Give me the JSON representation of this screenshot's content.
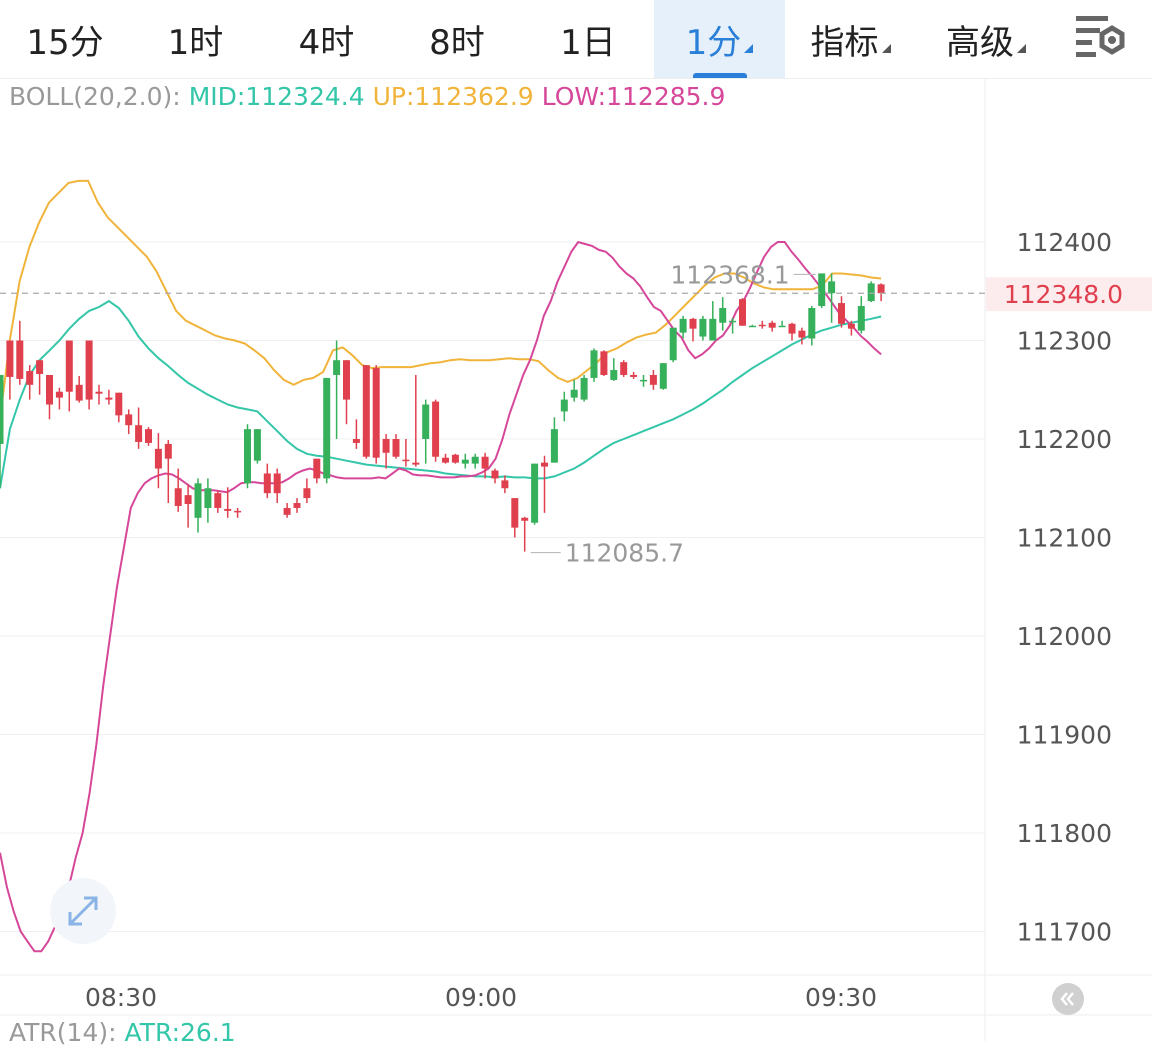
{
  "tabs": [
    {
      "label": "15分",
      "active": false,
      "dropdown": false
    },
    {
      "label": "1时",
      "active": false,
      "dropdown": false
    },
    {
      "label": "4时",
      "active": false,
      "dropdown": false
    },
    {
      "label": "8时",
      "active": false,
      "dropdown": false
    },
    {
      "label": "1日",
      "active": false,
      "dropdown": false
    },
    {
      "label": "1分",
      "active": true,
      "dropdown": true
    },
    {
      "label": "指标",
      "active": false,
      "dropdown": true
    },
    {
      "label": "高级",
      "active": false,
      "dropdown": true
    }
  ],
  "settings_icon": "chart-settings-icon",
  "legend": {
    "name": "BOLL(20,2.0):",
    "mid": "MID:112324.4",
    "up": "UP:112362.9",
    "low": "LOW:112285.9"
  },
  "atr": {
    "name": "ATR(14):",
    "value": "ATR:26.1"
  },
  "colors": {
    "up": "#36b05a",
    "down": "#e0404e",
    "mid": "#33c6a8",
    "upper": "#f0b43a",
    "lower": "#d6479a",
    "label": "#999999",
    "accent": "#2a7fd8"
  },
  "chart_data": {
    "type": "candlestick",
    "ylim": [
      111680,
      112480
    ],
    "y_ticks": [
      "112400",
      "112300",
      "112200",
      "112100",
      "112000",
      "111900",
      "111800",
      "111700"
    ],
    "x_ticks": [
      "08:30",
      "09:00",
      "09:30"
    ],
    "current_price": "112348.0",
    "high_label": "112368.1",
    "low_label": "112085.7",
    "candles": [
      [
        112195,
        112265,
        112150,
        112265
      ],
      [
        112300,
        112263,
        112240,
        112300
      ],
      [
        112300,
        112261,
        112255,
        112320
      ],
      [
        112269,
        112255,
        112240,
        112275
      ],
      [
        112280,
        112266,
        112245,
        112280
      ],
      [
        112265,
        112235,
        112220,
        112265
      ],
      [
        112248,
        112242,
        112230,
        112252
      ],
      [
        112300,
        112248,
        112228,
        112300
      ],
      [
        112255,
        112239,
        112237,
        112264
      ],
      [
        112300,
        112240,
        112230,
        112300
      ],
      [
        112248,
        112246,
        112235,
        112255
      ],
      [
        112242,
        112240,
        112235,
        112250
      ],
      [
        112247,
        112224,
        112217,
        112247
      ],
      [
        112225,
        112214,
        112205,
        112230
      ],
      [
        112214,
        112197,
        112190,
        112232
      ],
      [
        112210,
        112196,
        112193,
        112212
      ],
      [
        112190,
        112170,
        112150,
        112206
      ],
      [
        112195,
        112180,
        112135,
        112199
      ],
      [
        112150,
        112132,
        112126,
        112170
      ],
      [
        112143,
        112134,
        112110,
        112154
      ],
      [
        112120,
        112155,
        112105,
        112160
      ],
      [
        112130,
        112150,
        112115,
        112160
      ],
      [
        112145,
        112130,
        112125,
        112147
      ],
      [
        112129,
        112127,
        112120,
        112151
      ],
      [
        112127,
        112126,
        112120,
        112130
      ],
      [
        112155,
        112210,
        112150,
        112215
      ],
      [
        112178,
        112210,
        112175,
        112210
      ],
      [
        112165,
        112145,
        112140,
        112175
      ],
      [
        112165,
        112145,
        112135,
        112170
      ],
      [
        112130,
        112123,
        112120,
        112135
      ],
      [
        112135,
        112130,
        112125,
        112140
      ],
      [
        112150,
        112140,
        112135,
        112160
      ],
      [
        112180,
        112160,
        112155,
        112180
      ],
      [
        112160,
        112262,
        112155,
        112262
      ],
      [
        112265,
        112280,
        112200,
        112300
      ],
      [
        112280,
        112240,
        112215,
        112280
      ],
      [
        112200,
        112196,
        112190,
        112220
      ],
      [
        112275,
        112182,
        112180,
        112275
      ],
      [
        112272,
        112181,
        112175,
        112275
      ],
      [
        112200,
        112186,
        112170,
        112205
      ],
      [
        112200,
        112182,
        112180,
        112205
      ],
      [
        112179,
        112178,
        112172,
        112200
      ],
      [
        112176,
        112174,
        112172,
        112265
      ],
      [
        112200,
        112235,
        112175,
        112240
      ],
      [
        112238,
        112182,
        112177,
        112240
      ],
      [
        112181,
        112176,
        112175,
        112185
      ],
      [
        112184,
        112176,
        112175,
        112185
      ],
      [
        112175,
        112179,
        112170,
        112185
      ],
      [
        112175,
        112182,
        112170,
        112185
      ],
      [
        112182,
        112170,
        112160,
        112186
      ],
      [
        112168,
        112160,
        112155,
        112170
      ],
      [
        112158,
        112150,
        112145,
        112163
      ],
      [
        112140,
        112110,
        112100,
        112140
      ],
      [
        112120,
        112117,
        112085.7,
        112121
      ],
      [
        112115,
        112175,
        112113,
        112175
      ],
      [
        112176,
        112172,
        112125,
        112183
      ],
      [
        112176,
        112210,
        112176,
        112222
      ],
      [
        112228,
        112240,
        112218,
        112248
      ],
      [
        112242,
        112250,
        112238,
        112260
      ],
      [
        112240,
        112262,
        112238,
        112265
      ],
      [
        112262,
        112290,
        112258,
        112292
      ],
      [
        112289,
        112265,
        112264,
        112290
      ],
      [
        112260,
        112270,
        112259,
        112282
      ],
      [
        112278,
        112265,
        112263,
        112280
      ],
      [
        112265,
        112263,
        112261,
        112268
      ],
      [
        112260,
        112260,
        112253,
        112265
      ],
      [
        112265,
        112255,
        112250,
        112270
      ],
      [
        112251,
        112277,
        112250,
        112277
      ],
      [
        112280,
        112313,
        112278,
        112313
      ],
      [
        112308,
        112322,
        112302,
        112325
      ],
      [
        112322,
        112312,
        112299,
        112323
      ],
      [
        112304,
        112322,
        112300,
        112325
      ],
      [
        112300,
        112322,
        112300,
        112340
      ],
      [
        112318,
        112333,
        112310,
        112344
      ],
      [
        112320,
        112320,
        112307,
        112323
      ],
      [
        112342,
        112315,
        112315,
        112343
      ],
      [
        112315,
        112315,
        112315,
        112316
      ],
      [
        112316,
        112315,
        112312,
        112320
      ],
      [
        112318,
        112313,
        112309,
        112320
      ],
      [
        112315,
        112315,
        112315,
        112320
      ],
      [
        112317,
        112307,
        112300,
        112318
      ],
      [
        112310,
        112303,
        112296,
        112313
      ],
      [
        112302,
        112333,
        112295,
        112335
      ],
      [
        112335,
        112368.1,
        112333,
        112368.1
      ],
      [
        112348,
        112360,
        112318,
        112368
      ],
      [
        112338,
        112317,
        112313,
        112345
      ],
      [
        112317,
        112312,
        112305,
        112320
      ],
      [
        112310,
        112335,
        112307,
        112345
      ],
      [
        112340,
        112358,
        112339,
        112360
      ],
      [
        112357,
        112348,
        112340,
        112358
      ]
    ],
    "mid_series": [
      112150,
      112210,
      112240,
      112265,
      112280,
      112290,
      112300,
      112312,
      112322,
      112330,
      112334,
      112340,
      112333,
      112320,
      112304,
      112292,
      112282,
      112274,
      112265,
      112257,
      112251,
      112245,
      112240,
      112235,
      112232,
      112230,
      112228,
      112218,
      112208,
      112198,
      112190,
      112185,
      112183,
      112182,
      112180,
      112178,
      112176,
      112174,
      112173,
      112172,
      112171,
      112170,
      112169,
      112168,
      112167,
      112165,
      112164,
      112163,
      112162,
      112162,
      112161,
      112162,
      112161,
      112161,
      112160,
      112160,
      112162,
      112166,
      112170,
      112176,
      112183,
      112190,
      112196,
      112200,
      112204,
      112208,
      112212,
      112216,
      112220,
      112225,
      112230,
      112236,
      112243,
      112250,
      112258,
      112265,
      112272,
      112278,
      112284,
      112290,
      112296,
      112301,
      112306,
      112310,
      112313,
      112316,
      112318,
      112320,
      112322,
      112324.4
    ],
    "upper_series": [
      112220,
      112300,
      112360,
      112395,
      112420,
      112440,
      112450,
      112460,
      112462,
      112462,
      112440,
      112425,
      112415,
      112405,
      112395,
      112385,
      112370,
      112350,
      112330,
      112320,
      112315,
      112310,
      112305,
      112302,
      112300,
      112297,
      112290,
      112282,
      112270,
      112260,
      112255,
      112260,
      112262,
      112268,
      112290,
      112293,
      112285,
      112275,
      112272,
      112273,
      112273,
      112273,
      112273,
      112275,
      112277,
      112278,
      112280,
      112281,
      112280,
      112280,
      112280,
      112281,
      112282,
      112281,
      112281,
      112279,
      112270,
      112262,
      112258,
      112262,
      112270,
      112278,
      112288,
      112292,
      112298,
      112303,
      112306,
      112308,
      112316,
      112326,
      112336,
      112346,
      112356,
      112364,
      112368,
      112368,
      112364,
      112358,
      112354,
      112352,
      112352,
      112352,
      112352,
      112352,
      112356,
      112368,
      112368,
      112367,
      112366,
      112364,
      112362.9
    ],
    "lower_series": [
      111780,
      111745,
      111720,
      111700,
      111690,
      111680,
      111680,
      111690,
      111705,
      111720,
      111745,
      111775,
      111800,
      111840,
      111890,
      111950,
      112000,
      112050,
      112090,
      112130,
      112145,
      112155,
      112160,
      112163,
      112165,
      112164,
      112160,
      112155,
      112150,
      112148,
      112148,
      112148,
      112147,
      112146,
      112150,
      112155,
      112156,
      112156,
      112155,
      112155,
      112155,
      112156,
      112160,
      112165,
      112168,
      112170,
      112168,
      112165,
      112163,
      112161,
      112160,
      112160,
      112160,
      112160,
      112160,
      112161,
      112160,
      112165,
      112170,
      112168,
      112164,
      112163,
      112163,
      112162,
      112161,
      112161,
      112161,
      112162,
      112162,
      112163,
      112166,
      112170,
      112180,
      112200,
      112225,
      112245,
      112265,
      112280,
      112300,
      112325,
      112340,
      112360,
      112375,
      112390,
      112400,
      112398,
      112396,
      112392,
      112390,
      112384,
      112375,
      112368,
      112363,
      112355,
      112344,
      112334,
      112330,
      112320,
      112310,
      112303,
      112290,
      112282,
      112286,
      112292,
      112300,
      112305,
      112315,
      112330,
      112340,
      112354,
      112370,
      112385,
      112395,
      112400,
      112400,
      112390,
      112382,
      112373,
      112365,
      112356,
      112347,
      112337,
      112327,
      112320,
      112313,
      112305,
      112299,
      112292,
      112285.9
    ]
  }
}
